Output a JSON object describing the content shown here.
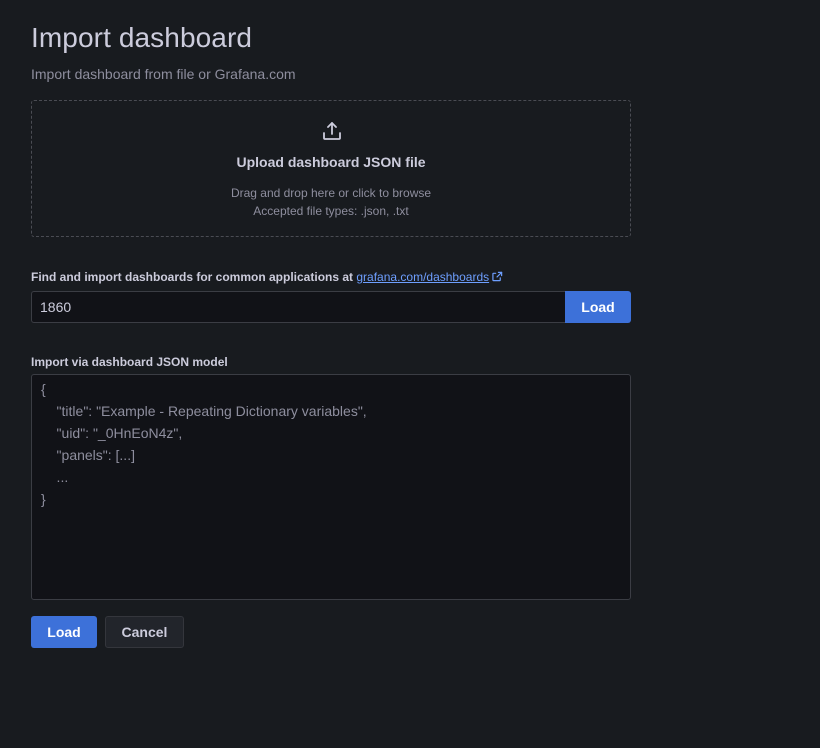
{
  "header": {
    "title": "Import dashboard",
    "subtitle": "Import dashboard from file or Grafana.com"
  },
  "upload": {
    "icon": "upload-icon",
    "heading": "Upload dashboard JSON file",
    "hint": "Drag and drop here or click to browse",
    "accepted_types": "Accepted file types: .json, .txt"
  },
  "gcom": {
    "label": "Find and import dashboards for common applications at",
    "link_text": "grafana.com/dashboards",
    "link_icon": "external-link-icon",
    "input_value": "1860",
    "load_label": "Load"
  },
  "json_model": {
    "label": "Import via dashboard JSON model",
    "placeholder_lines": [
      "{",
      "    \"title\": \"Example - Repeating Dictionary variables\",",
      "    \"uid\": \"_0HnEoN4z\",",
      "    \"panels\": [...]",
      "    ...",
      "}"
    ]
  },
  "footer": {
    "load_label": "Load",
    "cancel_label": "Cancel"
  },
  "colors": {
    "background": "#181b1f",
    "primary": "#3d71d9",
    "link": "#6e9fff",
    "text": "#ccccdc",
    "muted_text": "#8e8e9e"
  }
}
